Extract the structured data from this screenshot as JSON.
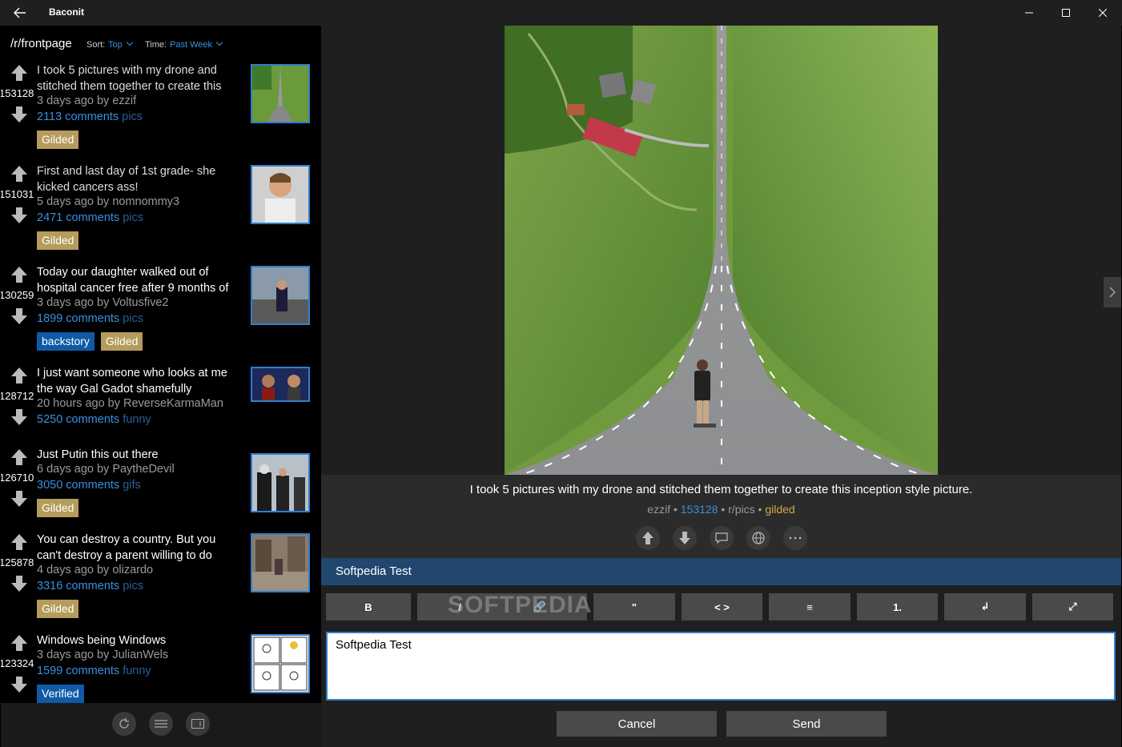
{
  "app": {
    "title": "Baconit"
  },
  "window": {
    "back_icon": "back-arrow-icon",
    "minimize_icon": "minimize-icon",
    "maximize_icon": "maximize-icon",
    "close_icon": "close-icon"
  },
  "subreddit": {
    "name": "/r/frontpage",
    "sort_label": "Sort:",
    "sort_value": "Top",
    "time_label": "Time:",
    "time_value": "Past Week"
  },
  "posts": [
    {
      "score": "153128",
      "title": "I took 5 pictures with my drone and stitched them together to create this",
      "meta": "3 days ago by ezzif",
      "comments": "2113 comments",
      "sub": "pics",
      "badges": [
        "Gilded"
      ]
    },
    {
      "score": "151031",
      "title": "First and last day of 1st grade- she kicked cancers ass!",
      "meta": "5 days ago by nomnommy3",
      "comments": "2471 comments",
      "sub": "pics",
      "badges": [
        "Gilded"
      ]
    },
    {
      "score": "130259",
      "title": "Today our daughter walked out of hospital cancer free after 9 months of",
      "meta": "3 days ago by Voltusfive2",
      "comments": "1899 comments",
      "sub": "pics",
      "badges": [
        "backstory",
        "Gilded"
      ]
    },
    {
      "score": "128712",
      "title": "I just want someone who looks at me the way Gal Gadot shamefully",
      "meta": "20 hours ago by ReverseKarmaMan",
      "comments": "5250 comments",
      "sub": "funny",
      "badges": []
    },
    {
      "score": "126710",
      "title": "Just Putin this out there",
      "meta": "6 days ago by PaytheDevil",
      "comments": "3050 comments",
      "sub": "gifs",
      "badges": [
        "Gilded"
      ]
    },
    {
      "score": "125878",
      "title": "You can destroy a country. But you can't destroy a parent willing to do",
      "meta": "4 days ago by olizardo",
      "comments": "3316 comments",
      "sub": "pics",
      "badges": [
        "Gilded"
      ]
    },
    {
      "score": "123324",
      "title": "Windows being Windows",
      "meta": "3 days ago by JulianWels",
      "comments": "1599 comments",
      "sub": "funny",
      "badges": [
        "Verified"
      ]
    }
  ],
  "footer": {
    "refresh_icon": "refresh-icon",
    "menu_icon": "menu-icon",
    "fullscreen_icon": "window-icon"
  },
  "viewer": {
    "title": "I took 5 pictures with my drone and stitched them together to create this inception style picture.",
    "author": "ezzif",
    "score": "153128",
    "subreddit": "r/pics",
    "gilded": "gilded",
    "sep": "•"
  },
  "actions": [
    "upvote-icon",
    "downvote-icon",
    "comment-icon",
    "globe-icon",
    "more-icon"
  ],
  "reply": {
    "header": "Softpedia Test",
    "toolbar": [
      "B",
      "I",
      "🔗",
      "\"",
      "< >",
      "≡",
      "1.",
      "↲",
      "⤢"
    ],
    "watermark": "SOFTPEDIA",
    "text": "Softpedia Test",
    "cancel": "Cancel",
    "send": "Send"
  },
  "colors": {
    "accent": "#3a8fe0",
    "gilded": "#b59b5c",
    "reply_header": "#22476e"
  }
}
